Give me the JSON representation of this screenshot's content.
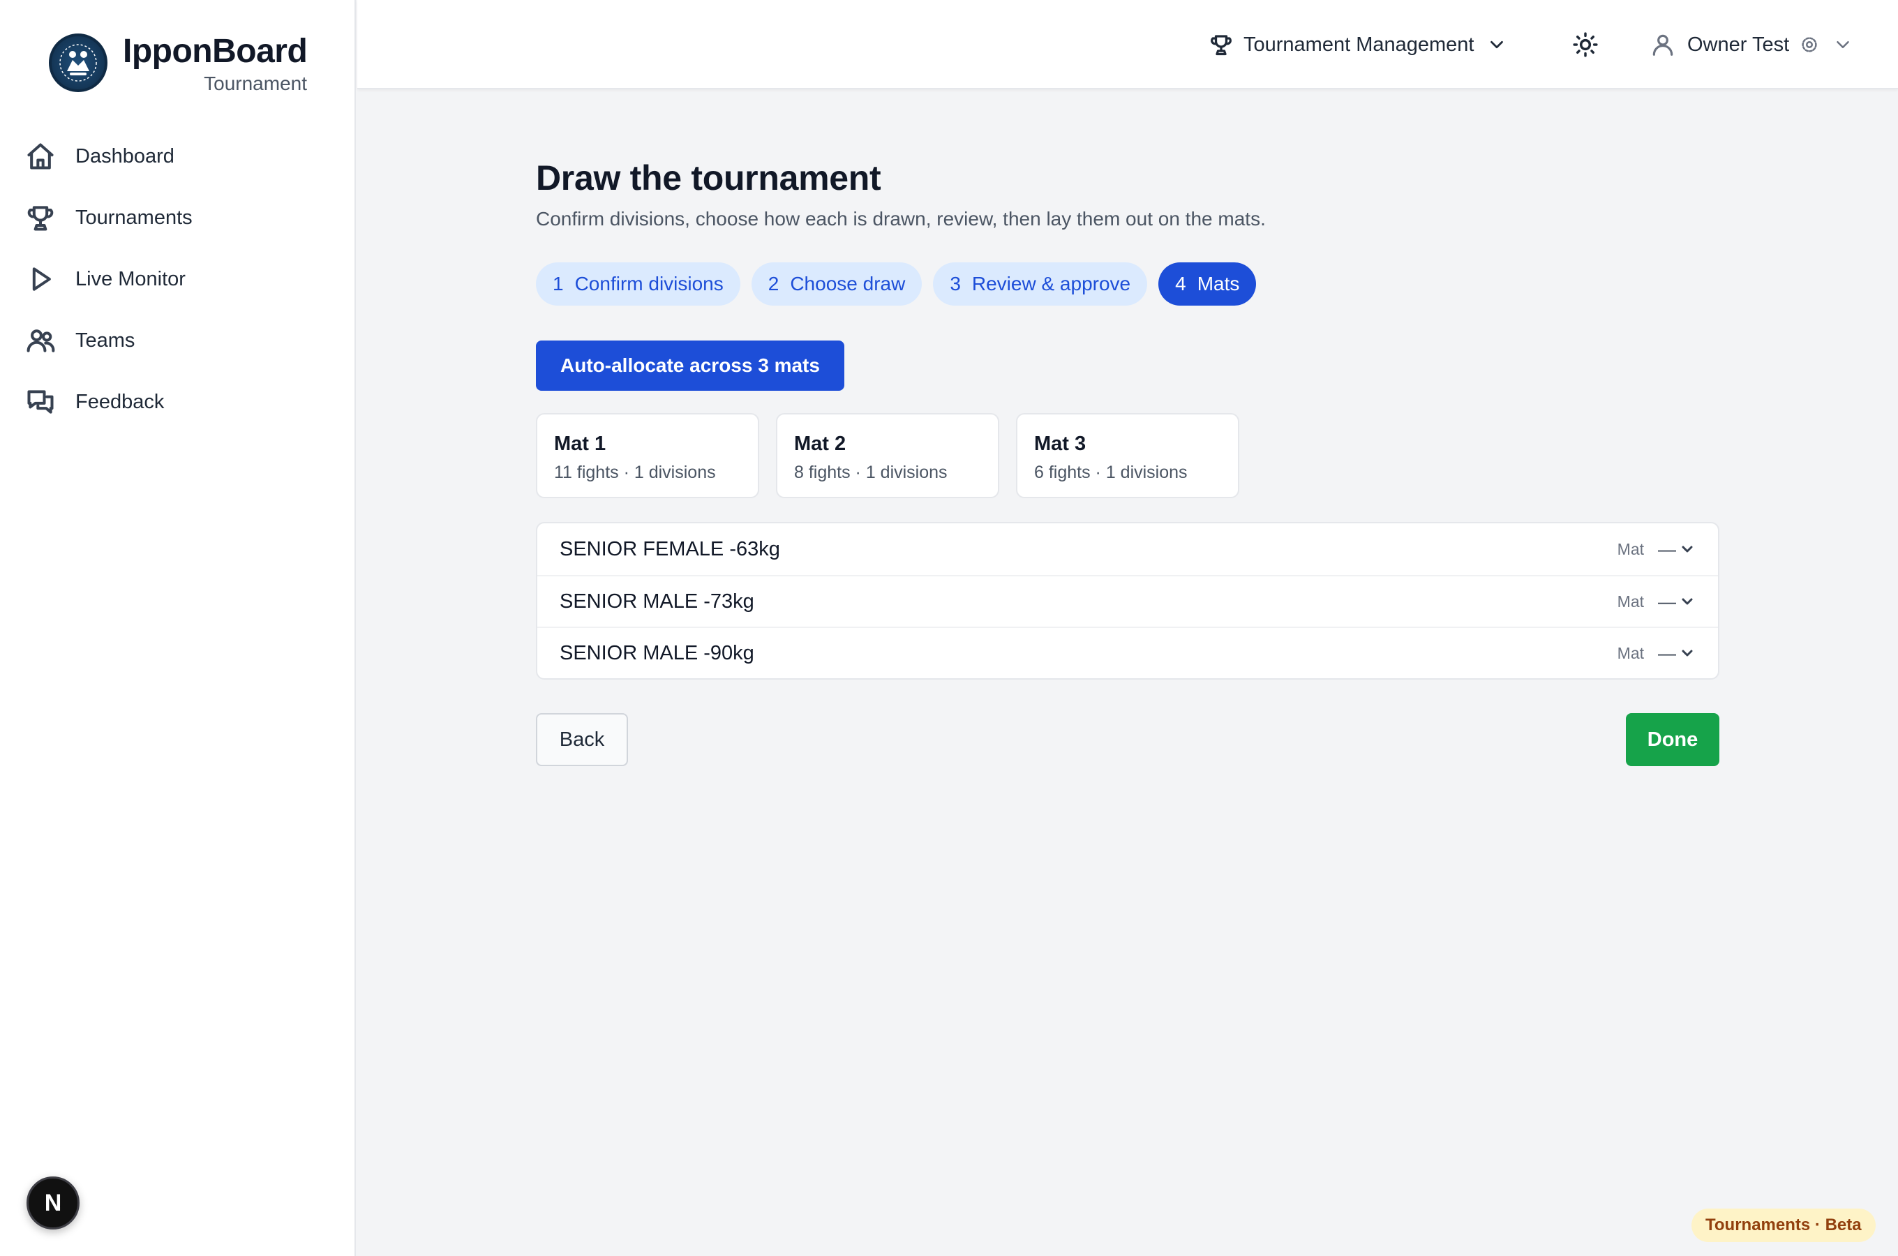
{
  "brand": {
    "name": "IpponBoard",
    "subtitle": "Tournament"
  },
  "sidebar": {
    "items": [
      {
        "label": "Dashboard",
        "icon": "home-icon"
      },
      {
        "label": "Tournaments",
        "icon": "trophy-icon"
      },
      {
        "label": "Live Monitor",
        "icon": "play-icon"
      },
      {
        "label": "Teams",
        "icon": "users-icon"
      },
      {
        "label": "Feedback",
        "icon": "chat-icon"
      }
    ],
    "badge": "N"
  },
  "topbar": {
    "section_label": "Tournament Management",
    "user_name": "Owner Test"
  },
  "page": {
    "title": "Draw the tournament",
    "subtitle": "Confirm divisions, choose how each is drawn, review, then lay them out on the mats."
  },
  "steps": [
    {
      "num": "1",
      "label": "Confirm divisions",
      "active": false
    },
    {
      "num": "2",
      "label": "Choose draw",
      "active": false
    },
    {
      "num": "3",
      "label": "Review & approve",
      "active": false
    },
    {
      "num": "4",
      "label": "Mats",
      "active": true
    }
  ],
  "auto_allocate_label": "Auto-allocate across 3 mats",
  "mats": [
    {
      "name": "Mat 1",
      "meta": "11 fights · 1 divisions"
    },
    {
      "name": "Mat 2",
      "meta": "8 fights · 1 divisions"
    },
    {
      "name": "Mat 3",
      "meta": "6 fights · 1 divisions"
    }
  ],
  "divisions": [
    {
      "name": "SENIOR FEMALE -63kg",
      "mat_label": "Mat",
      "mat_value": "—"
    },
    {
      "name": "SENIOR MALE -73kg",
      "mat_label": "Mat",
      "mat_value": "—"
    },
    {
      "name": "SENIOR MALE -90kg",
      "mat_label": "Mat",
      "mat_value": "—"
    }
  ],
  "actions": {
    "back": "Back",
    "done": "Done"
  },
  "footer_badge": "Tournaments · Beta",
  "colors": {
    "primary": "#1d4ed8",
    "step_bg": "#dbeafe",
    "success": "#16a34a",
    "beta_bg": "#fef3c7"
  }
}
